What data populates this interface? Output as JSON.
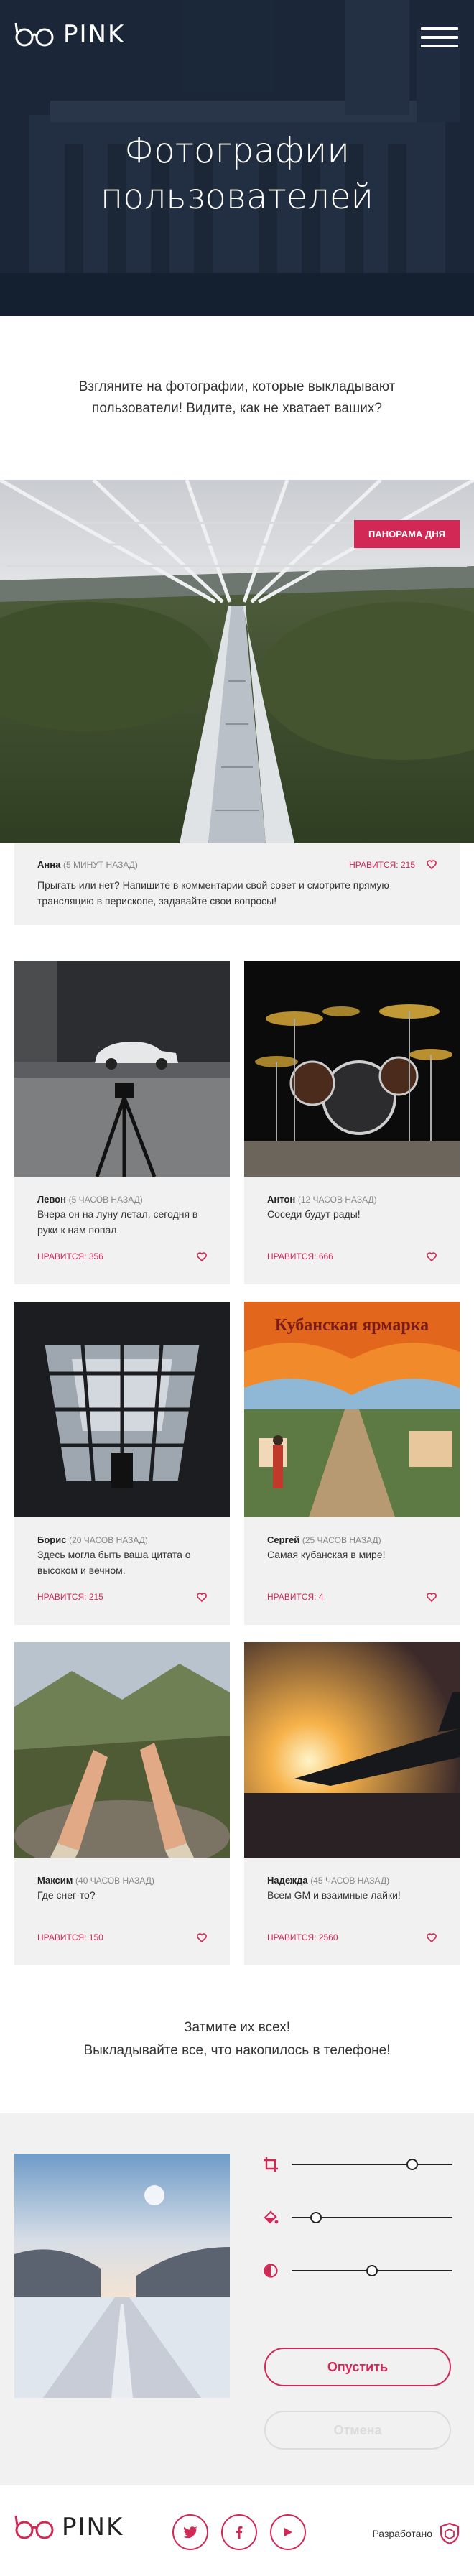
{
  "header": {
    "logo_text": "PINK",
    "title_line1": "Фотографии",
    "title_line2": "пользователей"
  },
  "intro": {
    "text": "Взгляните на фотографии, которые выкладывают пользователи! Видите, как не хватает ваших?"
  },
  "panorama": {
    "badge": "Панорама дня",
    "author": "Анна",
    "time": "(5 минут назад)",
    "likes": "Нравится: 215",
    "text": "Прыгать или нет? Напишите в комментарии свой совет и смотрите прямую трансляцию в перископе, задавайте свои вопросы!"
  },
  "posts": [
    {
      "author": "Левон",
      "time": "(5 часов назад)",
      "text": "Вчера он на луну летал, сегодня в руки к нам попал.",
      "likes": "Нравится: 356"
    },
    {
      "author": "Антон",
      "time": "(12 часов назад)",
      "text": "Соседи будут рады!",
      "likes": "Нравится: 666"
    },
    {
      "author": "Борис",
      "time": "(20 часов назад)",
      "text": "Здесь могла быть ваша цитата о высоком и вечном.",
      "likes": "Нравится: 215"
    },
    {
      "author": "Сергей",
      "time": "(25 часов назад)",
      "text": "Самая кубанская в мире!",
      "likes": "Нравится: 4",
      "sign_text": "Кубанская ярмарка"
    },
    {
      "author": "Максим",
      "time": "(40 часов назад)",
      "text": "Где снег-то?",
      "likes": "Нравится: 150"
    },
    {
      "author": "Надежда",
      "time": "(45 часов назад)",
      "text": "Всем GM и взаимные лайки!",
      "likes": "Нравится: 2560"
    }
  ],
  "showoff": {
    "line1": "Затмите их всех!",
    "line2": "Выкладывайте все, что накопилось в телефоне!"
  },
  "upload": {
    "crop_level": 0.75,
    "fill_level": 0.15,
    "contrast_level": 0.5,
    "publish_label": "Опустить",
    "cancel_label": "Отмена"
  },
  "footer": {
    "logo_text": "PINK",
    "developed_by": "Разработано"
  },
  "colors": {
    "accent": "#d22856",
    "card_bg": "#f1f1f1",
    "hero_overlay": "#0e1a2c"
  }
}
